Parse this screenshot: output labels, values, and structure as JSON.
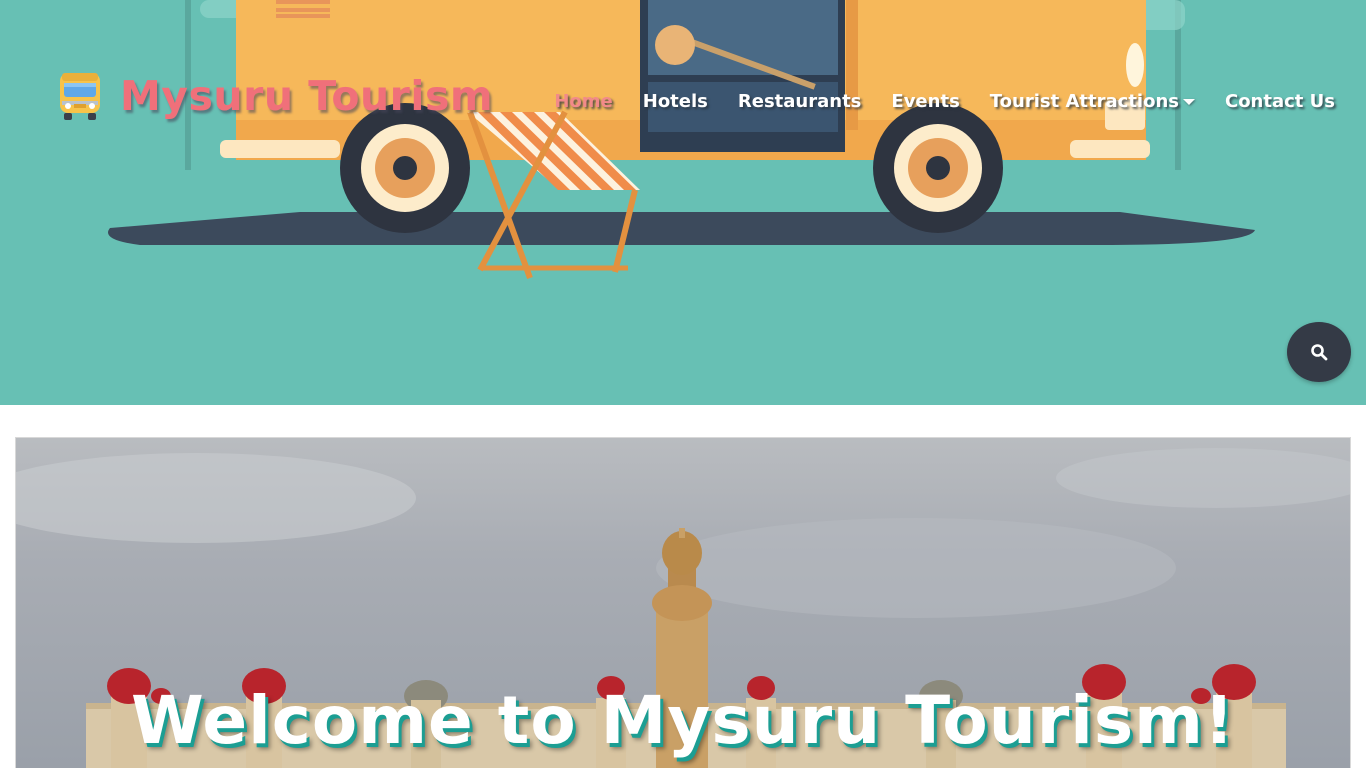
{
  "brand": {
    "title": "Mysuru Tourism",
    "icon": "bus-icon",
    "color": "#f0707a"
  },
  "nav": {
    "items": [
      {
        "label": "Home",
        "active": true
      },
      {
        "label": "Hotels",
        "active": false
      },
      {
        "label": "Restaurants",
        "active": false
      },
      {
        "label": "Events",
        "active": false
      },
      {
        "label": "Tourist Attractions",
        "active": false,
        "dropdown": true
      },
      {
        "label": "Contact Us",
        "active": false
      }
    ]
  },
  "search": {
    "icon": "search-icon"
  },
  "banner": {
    "heading": "Welcome to Mysuru Tourism!",
    "image": "mysore-palace"
  },
  "colors": {
    "hero_background": "#67c0b4",
    "nav_active": "#f28a8a",
    "search_button": "#343a46",
    "heading_shadow": "#1c9e93"
  }
}
